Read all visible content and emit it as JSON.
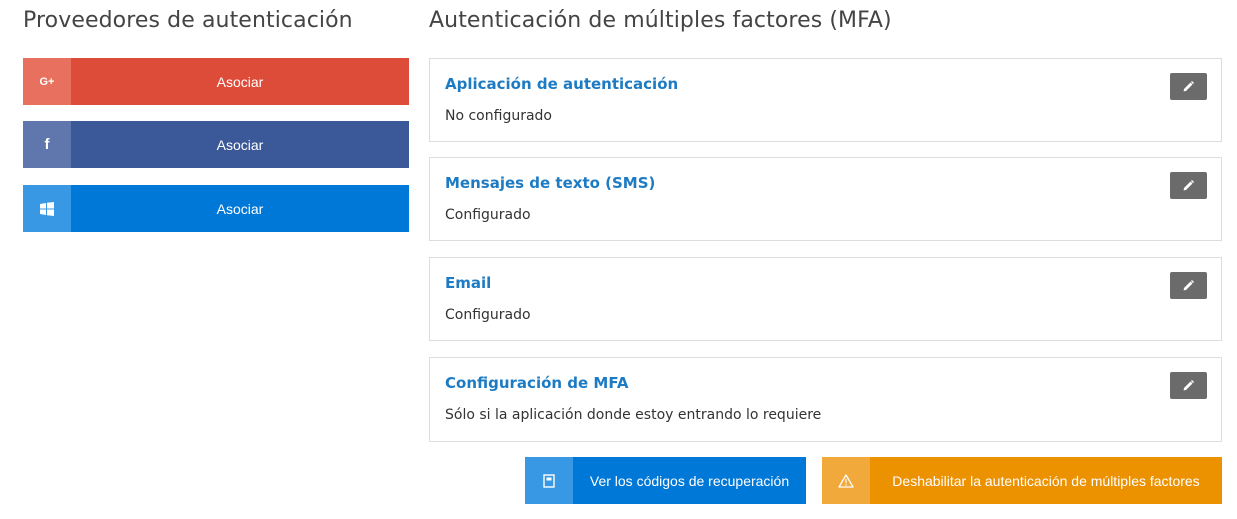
{
  "auth_providers": {
    "title": "Proveedores de autenticación",
    "items": [
      {
        "provider_icon": "google-plus-icon",
        "icon_text": "G+",
        "label": "Asociar",
        "color": "#dd4b39",
        "icon_color": "#e8705f"
      },
      {
        "provider_icon": "facebook-icon",
        "icon_text": "f",
        "label": "Asociar",
        "color": "#3b5998",
        "icon_color": "#5f77ad"
      },
      {
        "provider_icon": "windows-icon",
        "label": "Asociar",
        "color": "#0078d7",
        "icon_color": "#3898e3"
      }
    ]
  },
  "mfa": {
    "title": "Autenticación de múltiples factores (MFA)",
    "cards": [
      {
        "title": "Aplicación de autenticación",
        "status": "No configurado",
        "edit_icon": "pencil-icon"
      },
      {
        "title": "Mensajes de texto (SMS)",
        "status": "Configurado",
        "edit_icon": "pencil-icon"
      },
      {
        "title": "Email",
        "status": "Configurado",
        "edit_icon": "pencil-icon"
      },
      {
        "title": "Configuración de MFA",
        "status": "Sólo si la aplicación donde estoy entrando lo requiere",
        "edit_icon": "pencil-icon"
      }
    ],
    "actions": {
      "recovery_codes_label": "Ver los códigos de recuperación",
      "recovery_icon": "document-icon",
      "disable_mfa_label": "Deshabilitar la autenticación de múltiples factores",
      "disable_icon": "warning-icon"
    }
  },
  "colors": {
    "accent_title": "#1d7bc4",
    "edit_button": "#6b6b6b",
    "primary": "#0078d7",
    "warning": "#ec9100"
  }
}
